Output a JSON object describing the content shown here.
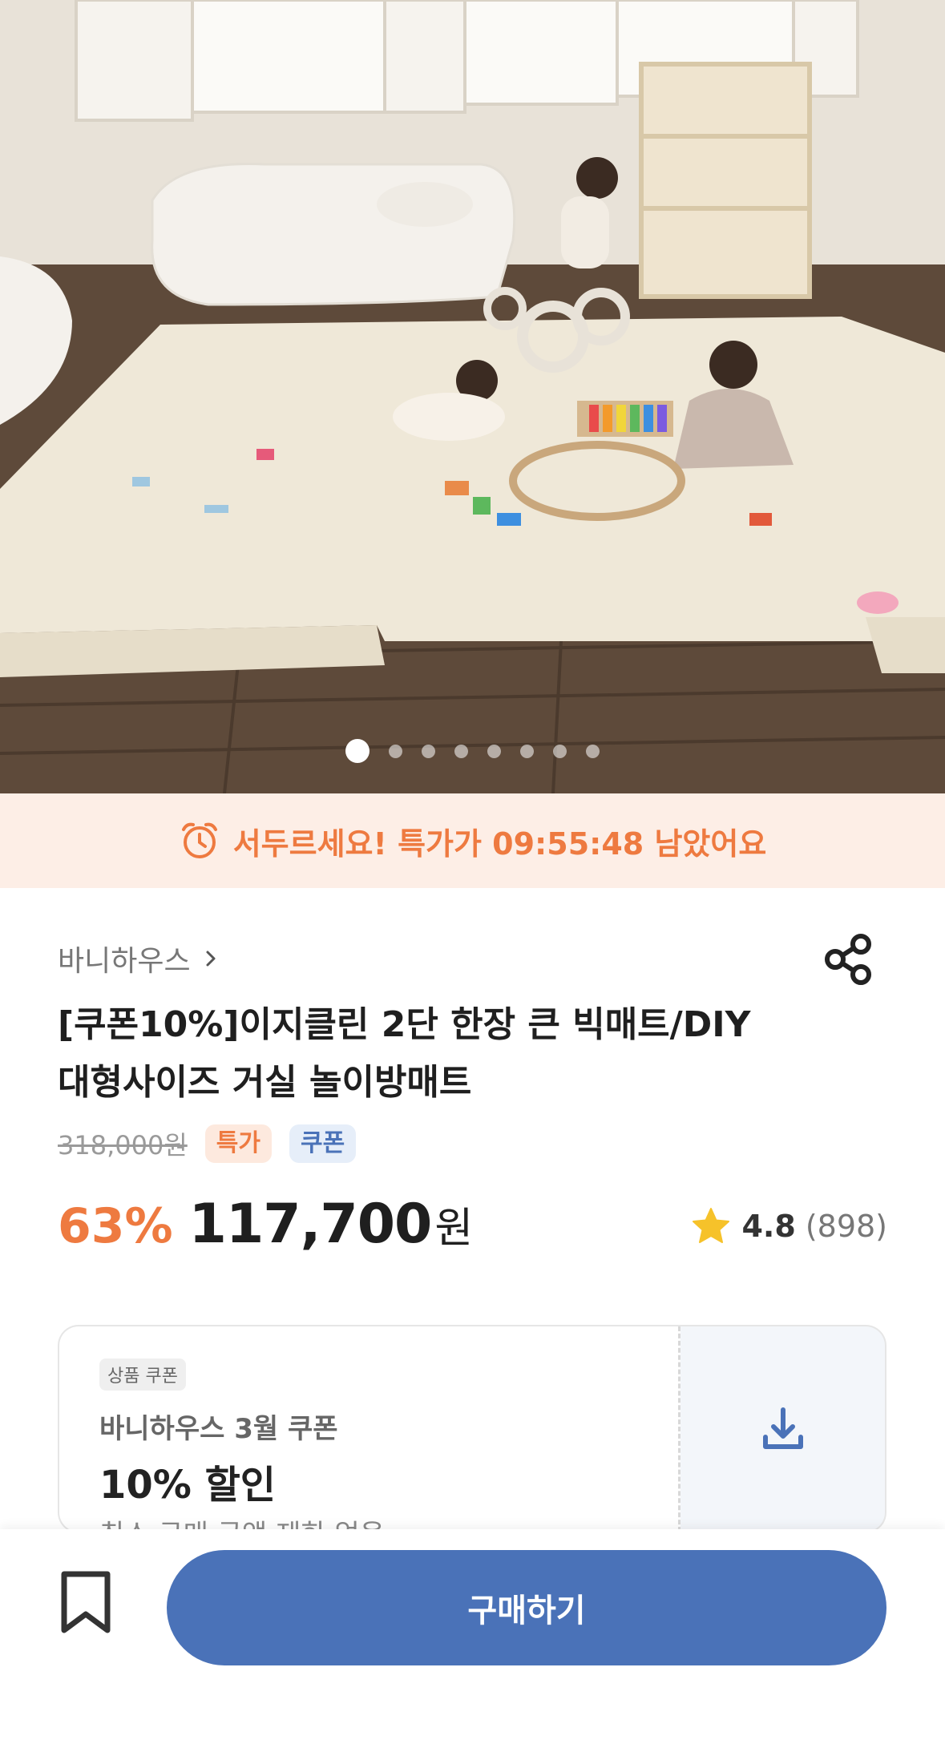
{
  "hero": {
    "image_description_icon": "product-photo",
    "carousel_total": 8,
    "carousel_active_index": 0
  },
  "deal": {
    "icon": "alarm-clock-icon",
    "text": "서두르세요! 특가가 09:55:48 남았어요"
  },
  "product": {
    "brand": "바니하우스",
    "title_line1": "[쿠폰10%]이지클린 2단 한장 큰 빅매트/DIY",
    "title_line2": "대형사이즈 거실 놀이방매트",
    "original_price": "318,000원",
    "tags": [
      "특가",
      "쿠폰"
    ],
    "discount": "63%",
    "price": "117,700",
    "currency": "원",
    "rating": "4.8",
    "review_count": "(898)"
  },
  "coupon": {
    "badge": "상품 쿠폰",
    "name": "바니하우스 3월 쿠폰",
    "value": "10% 할인",
    "note": "최소 구매 금액 제한 없음"
  },
  "bottom": {
    "buy_label": "구매하기"
  },
  "colors": {
    "accent_orange": "#ee7a40",
    "brand_blue": "#4a72b8",
    "deal_bg": "#fdeee6"
  }
}
